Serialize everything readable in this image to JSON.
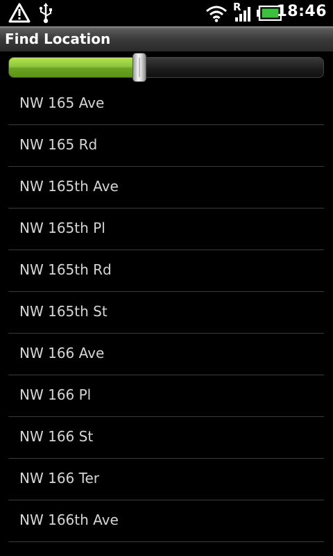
{
  "status_bar": {
    "time": "18:46",
    "roaming_indicator": "R",
    "icons": [
      "warning-icon",
      "usb-icon",
      "wifi-icon",
      "signal-icon",
      "battery-icon"
    ]
  },
  "title_bar": {
    "title": "Find Location"
  },
  "progress": {
    "value_fraction": 0.41,
    "fill_color": "#8cc63f"
  },
  "locations": [
    {
      "label": "NW 165 Ave"
    },
    {
      "label": "NW 165 Rd"
    },
    {
      "label": "NW 165th Ave"
    },
    {
      "label": "NW 165th Pl"
    },
    {
      "label": "NW 165th Rd"
    },
    {
      "label": "NW 165th St"
    },
    {
      "label": "NW 166 Ave"
    },
    {
      "label": "NW 166 Pl"
    },
    {
      "label": "NW 166 St"
    },
    {
      "label": "NW 166 Ter"
    },
    {
      "label": "NW 166th Ave"
    }
  ]
}
